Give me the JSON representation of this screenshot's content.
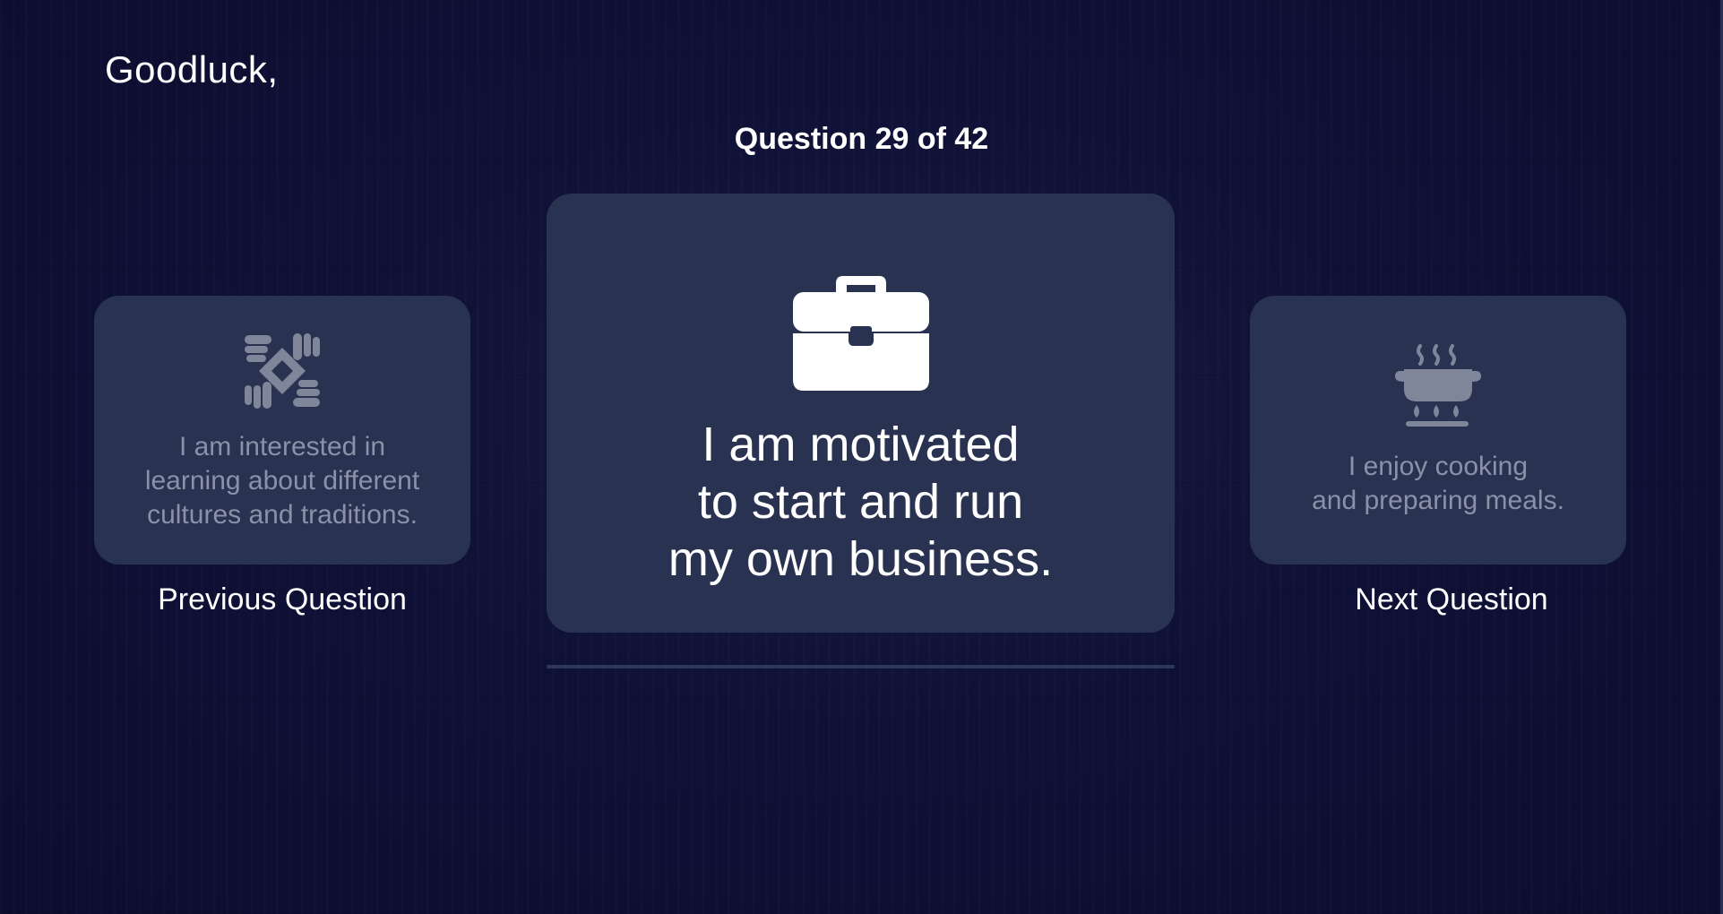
{
  "header": {
    "greeting": "Goodluck,",
    "question_counter": "Question 29 of 42"
  },
  "current_question": {
    "icon": "briefcase-icon",
    "lines": [
      "I am motivated",
      "to start and run",
      "my own business."
    ]
  },
  "previous_question": {
    "icon": "hands-circle-icon",
    "lines": [
      "I am interested in",
      "learning about different",
      "cultures and traditions."
    ],
    "nav_label": "Previous Question"
  },
  "next_question": {
    "icon": "cooking-pot-icon",
    "lines": [
      "I enjoy cooking",
      "and preparing meals."
    ],
    "nav_label": "Next Question"
  },
  "colors": {
    "background": "#0f1036",
    "card": "#293250",
    "muted_text": "#8a91a8",
    "text": "#ffffff"
  }
}
